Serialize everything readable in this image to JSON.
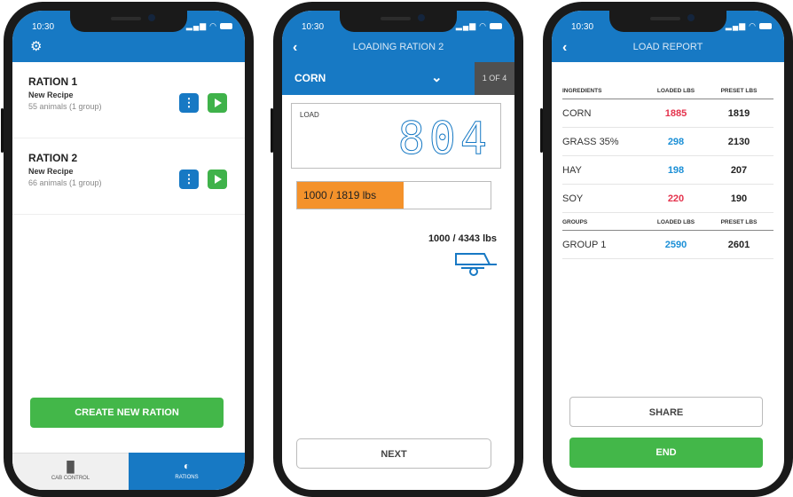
{
  "colors": {
    "brand_blue": "#1779c4",
    "green": "#43b749",
    "orange": "#f4922b",
    "red": "#e4324c",
    "cyan": "#1b8fd6"
  },
  "status": {
    "time": "10:30"
  },
  "rations_screen": {
    "settings_icon": "gear-icon",
    "rations": [
      {
        "title": "RATION 1",
        "recipe": "New Recipe",
        "info": "55 animals (1 group)"
      },
      {
        "title": "RATION 2",
        "recipe": "New Recipe",
        "info": "66 animals (1 group)"
      }
    ],
    "create_label": "CREATE NEW RATION",
    "tabs": [
      {
        "label": "CAB CONTROL",
        "icon": "bar-chart-icon"
      },
      {
        "label": "RATIONS",
        "icon": "pie-chart-icon"
      }
    ]
  },
  "loading_screen": {
    "title": "LOADING RATION 2",
    "ingredient": "CORN",
    "step": "1 OF 4",
    "load_label": "LOAD",
    "load_value": "804",
    "progress_text": "1000 / 1819 lbs",
    "progress_fraction": 0.55,
    "total_text": "1000 / 4343 lbs",
    "next_label": "NEXT"
  },
  "report_screen": {
    "title": "LOAD REPORT",
    "ingredient_headers": [
      "INGREDIENTS",
      "LOADED LBS",
      "PRESET LBS"
    ],
    "ingredients": [
      {
        "name": "CORN",
        "loaded": "1885",
        "preset": "1819",
        "color": "#e4324c"
      },
      {
        "name": "GRASS 35%",
        "loaded": "298",
        "preset": "2130",
        "color": "#1b8fd6"
      },
      {
        "name": "HAY",
        "loaded": "198",
        "preset": "207",
        "color": "#1b8fd6"
      },
      {
        "name": "SOY",
        "loaded": "220",
        "preset": "190",
        "color": "#e4324c"
      }
    ],
    "group_headers": [
      "GROUPS",
      "LOADED LBS",
      "PRESET LBS"
    ],
    "groups": [
      {
        "name": "GROUP 1",
        "loaded": "2590",
        "preset": "2601",
        "color": "#1b8fd6"
      }
    ],
    "share_label": "SHARE",
    "end_label": "END"
  }
}
